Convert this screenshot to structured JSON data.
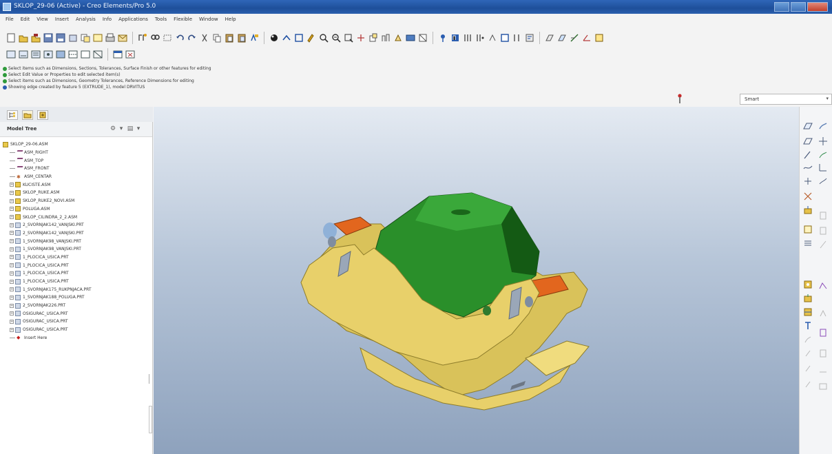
{
  "window": {
    "title": "SKLOP_29-06 (Active) - Creo Elements/Pro 5.0"
  },
  "menu": [
    "File",
    "Edit",
    "View",
    "Insert",
    "Analysis",
    "Info",
    "Applications",
    "Tools",
    "Flexible",
    "Window",
    "Help"
  ],
  "messages": [
    "Select items such as Dimensions, Sections, Tolerances, Surface Finish or other features for editing",
    "Select Edit Value or Properties to edit selected item(s)",
    "Select items such as Dimensions, Geometry Tolerances, Reference Dimensions for editing",
    "Showing edge created by feature 5 (EXTRUDE_1), model ",
    "DRVITUS"
  ],
  "filter": {
    "value": "Smart"
  },
  "nav_tabs": [
    "Model Tree",
    "Folder Browser",
    "Favorites"
  ],
  "model_tree": {
    "title": "Model Tree",
    "root": "SKLOP_29-06.ASM",
    "items": [
      {
        "label": "ASM_RIGHT",
        "icon": "datum-plane-icon",
        "expandable": false
      },
      {
        "label": "ASM_TOP",
        "icon": "datum-plane-icon",
        "expandable": false
      },
      {
        "label": "ASM_FRONT",
        "icon": "datum-plane-icon",
        "expandable": false
      },
      {
        "label": "ASM_CENTAR",
        "icon": "csys-icon",
        "expandable": false
      },
      {
        "label": "KUCISTE.ASM",
        "icon": "assembly-icon",
        "expandable": true
      },
      {
        "label": "SKLOP_RUKE.ASM",
        "icon": "assembly-icon",
        "expandable": true
      },
      {
        "label": "SKLOP_RUKE2_NOVI.ASM",
        "icon": "assembly-icon",
        "expandable": true
      },
      {
        "label": "POLUGA.ASM",
        "icon": "assembly-icon",
        "expandable": true
      },
      {
        "label": "SKLOP_CILINDRA_2_2.ASM",
        "icon": "assembly-icon",
        "expandable": true
      },
      {
        "label": "2_SVORNJAK142_VANJSKI.PRT",
        "icon": "part-icon",
        "expandable": true
      },
      {
        "label": "2_SVORNJAK142_VANJSKI.PRT",
        "icon": "part-icon",
        "expandable": true
      },
      {
        "label": "1_SVORNJAK98_VANJSKI.PRT",
        "icon": "part-icon",
        "expandable": true
      },
      {
        "label": "1_SVORNJAK98_VANJSKI.PRT",
        "icon": "part-icon",
        "expandable": true
      },
      {
        "label": "1_PLOCICA_USICA.PRT",
        "icon": "part-icon",
        "expandable": true
      },
      {
        "label": "1_PLOCICA_USICA.PRT",
        "icon": "part-icon",
        "expandable": true
      },
      {
        "label": "1_PLOCICA_USICA.PRT",
        "icon": "part-icon",
        "expandable": true
      },
      {
        "label": "1_PLOCICA_USICA.PRT",
        "icon": "part-icon",
        "expandable": true
      },
      {
        "label": "1_SVORNJAK175_RUKPNJACA.PRT",
        "icon": "part-icon",
        "expandable": true
      },
      {
        "label": "1_SVORNJAK188_POLUGA.PRT",
        "icon": "part-icon",
        "expandable": true
      },
      {
        "label": "2_SVORNJAK226.PRT",
        "icon": "part-icon",
        "expandable": true
      },
      {
        "label": "OSIGURAC_USICA.PRT",
        "icon": "part-icon",
        "expandable": true
      },
      {
        "label": "OSIGURAC_USICA.PRT",
        "icon": "part-icon",
        "expandable": true
      },
      {
        "label": "OSIGURAC_USICA.PRT",
        "icon": "part-icon",
        "expandable": true
      },
      {
        "label": "Insert Here",
        "icon": "insert-here-icon",
        "expandable": false
      }
    ]
  },
  "colors": {
    "title_bar": "#1e4f9a",
    "viewport_top": "#e4eaf2",
    "viewport_bottom": "#8ea2bd",
    "model_yellow": "#e8d06a",
    "model_green": "#1f7a1f",
    "model_orange": "#e2661e"
  }
}
